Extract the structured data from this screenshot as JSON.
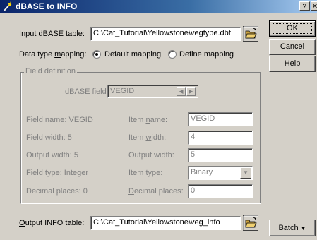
{
  "window": {
    "title": "dBASE to INFO",
    "help_button": "?",
    "close_button": "✕"
  },
  "input": {
    "label_hotkey": "I",
    "label_rest": "nput dBASE table:",
    "value": "C:\\Cat_Tutorial\\Yellowstone\\vegtype.dbf"
  },
  "mapping": {
    "label_prefix": "Data type ",
    "label_hotkey": "m",
    "label_rest": "apping:",
    "default_label": "Default mapping",
    "define_label": "Define mapping",
    "selected": "default"
  },
  "definition": {
    "legend": "Field definition",
    "dbase_field_label": "dBASE field:",
    "dbase_field_value": "VEGID",
    "rows": [
      {
        "left": "Field name: VEGID",
        "right_pre": "Item ",
        "right_hotkey": "n",
        "right_post": "ame:",
        "value": "VEGID"
      },
      {
        "left": "Field width: 5",
        "right_pre": "Item ",
        "right_hotkey": "w",
        "right_post": "idth:",
        "value": "4"
      },
      {
        "left": "Output width: 5",
        "right_pre": "Output width:",
        "right_hotkey": "",
        "right_post": "",
        "value": "5"
      },
      {
        "left": "Field type: Integer",
        "right_pre": "Item ",
        "right_hotkey": "t",
        "right_post": "ype:",
        "value": "Binary"
      },
      {
        "left": "Decimal places: 0",
        "right_pre": "",
        "right_hotkey": "D",
        "right_post": "ecimal places:",
        "value": "0"
      }
    ]
  },
  "output": {
    "label_hotkey": "O",
    "label_rest": "utput INFO table:",
    "value": "C:\\Cat_Tutorial\\Yellowstone\\veg_info"
  },
  "buttons": {
    "ok": "OK",
    "cancel": "Cancel",
    "help": "Help",
    "batch": "Batch",
    "batch_arrow": "▼"
  },
  "icons": {
    "title": "wand-icon",
    "browse": "open-folder-icon",
    "dropdown": "chevron-down-icon",
    "spin_left": "chevron-left-icon",
    "spin_right": "chevron-right-icon"
  },
  "colors": {
    "titlebar_start": "#0a246a",
    "titlebar_end": "#a6caf0",
    "face": "#d4d0c8",
    "disabled_text": "#808080"
  }
}
